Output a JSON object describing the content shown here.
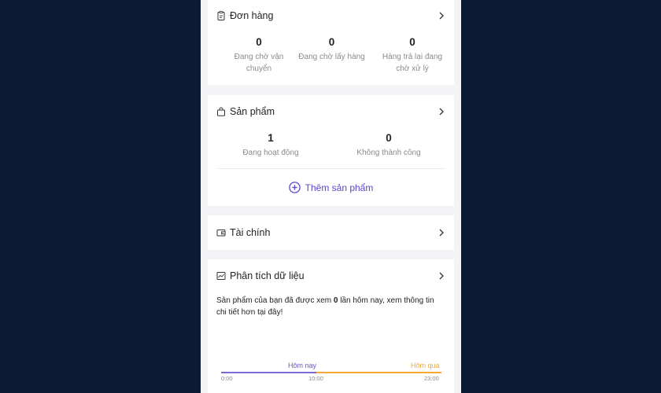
{
  "orders": {
    "title": "Đơn hàng",
    "icon": "clipboard-icon",
    "stats": [
      {
        "value": "0",
        "label_line1": "Đang chờ vận",
        "label_line2": "chuyển"
      },
      {
        "value": "0",
        "label_line1": "Đang chờ lấy hàng",
        "label_line2": ""
      },
      {
        "value": "0",
        "label_line1": "Hàng trả lại đang",
        "label_line2": "chờ xử lý"
      }
    ]
  },
  "products": {
    "title": "Sản phẩm",
    "icon": "shopping-bag-icon",
    "stats": [
      {
        "value": "1",
        "label": "Đang hoạt động"
      },
      {
        "value": "0",
        "label": "Không thành công"
      }
    ],
    "add_label": "Thêm sản phẩm"
  },
  "finance": {
    "title": "Tài chính",
    "icon": "wallet-icon"
  },
  "analytics": {
    "title": "Phân tích dữ liệu",
    "icon": "line-chart-icon",
    "desc_before": "Sản phẩm của bạn đã được xem ",
    "desc_count": "0",
    "desc_after": " lần hôm nay, xem thông tin chi tiết hơn tại đây!",
    "timeline": {
      "today_label": "Hôm nay",
      "yesterday_label": "Hôm qua",
      "ticks": [
        "0:00",
        "10:00",
        "23:00"
      ]
    }
  },
  "colors": {
    "background": "#0c1a33",
    "accent": "#5b46c9",
    "today_line": "#7b6bd6",
    "yesterday_line": "#f2a93b"
  }
}
